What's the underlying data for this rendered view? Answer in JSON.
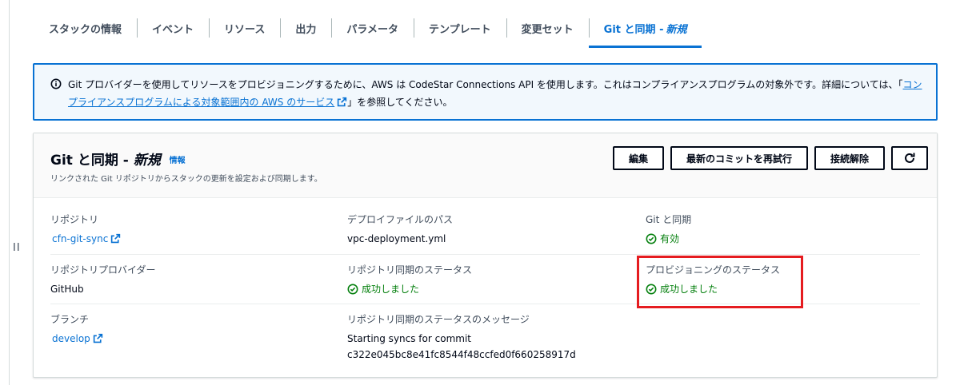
{
  "tabs": [
    {
      "label": "スタックの情報"
    },
    {
      "label": "イベント"
    },
    {
      "label": "リソース"
    },
    {
      "label": "出力"
    },
    {
      "label": "パラメータ"
    },
    {
      "label": "テンプレート"
    },
    {
      "label": "変更セット"
    },
    {
      "label": "Git と同期 -",
      "badge": "新規",
      "active": true
    }
  ],
  "alert": {
    "icon": "info-icon",
    "text_before": "Git プロバイダーを使用してリソースをプロビジョニングするために、AWS は CodeStar Connections API を使用します。これはコンプライアンスプログラムの対象外です。詳細については、「",
    "link": "コンプライアンスプログラムによる対象範囲内の AWS のサービス",
    "text_after": "」を参照してください。"
  },
  "panel": {
    "title": "Git と同期 -",
    "title_badge": "新規",
    "info_link": "情報",
    "subtitle": "リンクされた Git リポジトリからスタックの更新を設定および同期します。",
    "buttons": {
      "edit": "編集",
      "retry": "最新のコミットを再試行",
      "disconnect": "接続解除",
      "refresh_icon": "refresh-icon"
    },
    "fields": {
      "repository_label": "リポジトリ",
      "repository_value": "cfn-git-sync",
      "deploy_path_label": "デプロイファイルのパス",
      "deploy_path_value": "vpc-deployment.yml",
      "git_sync_label": "Git と同期",
      "git_sync_value": "有効",
      "provider_label": "リポジトリプロバイダー",
      "provider_value": "GitHub",
      "repo_sync_status_label": "リポジトリ同期のステータス",
      "repo_sync_status_value": "成功しました",
      "provisioning_status_label": "プロビジョニングのステータス",
      "provisioning_status_value": "成功しました",
      "branch_label": "ブランチ",
      "branch_value": "develop",
      "status_message_label": "リポジトリ同期のステータスのメッセージ",
      "status_message_line1": "Starting syncs for commit",
      "status_message_line2": "c322e045bc8e41fc8544f48ccfed0f660258917d"
    }
  },
  "colors": {
    "link": "#0972d3",
    "success": "#037f0c",
    "highlight": "#e51c20"
  }
}
